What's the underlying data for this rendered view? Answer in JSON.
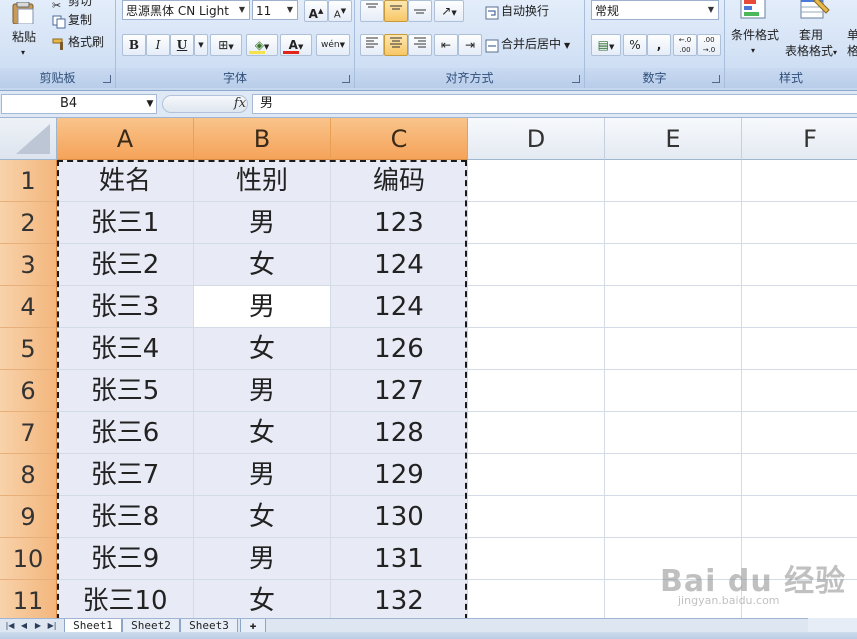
{
  "ribbon": {
    "clipboard": {
      "title": "剪贴板",
      "paste": "粘贴",
      "cut": "剪切",
      "copy": "复制",
      "format_painter": "格式刷"
    },
    "font": {
      "title": "字体",
      "font_name": "思源黑体 CN Light",
      "font_size": "11",
      "bold": "B",
      "italic": "I",
      "underline": "U",
      "font_color_glyph": "A",
      "phonetic": "wén",
      "grow": "A",
      "shrink": "A"
    },
    "alignment": {
      "title": "对齐方式",
      "wrap_text": "自动换行",
      "merge_center": "合并后居中"
    },
    "number": {
      "title": "数字",
      "format": "常规",
      "percent": "%",
      "comma": ",",
      "inc_decimal": "←.0 .00",
      "dec_decimal": ".00 →.0"
    },
    "styles": {
      "title": "样式",
      "conditional": "条件格式",
      "table_format_1": "套用",
      "table_format_2": "表格格式",
      "cell_styles": "单",
      "cell_styles_2": "格"
    }
  },
  "formula_bar": {
    "cell_ref": "B4",
    "fx": "fx",
    "content": "男"
  },
  "grid": {
    "columns": [
      "A",
      "B",
      "C",
      "D",
      "E",
      "F"
    ],
    "rows": [
      "1",
      "2",
      "3",
      "4",
      "5",
      "6",
      "7",
      "8",
      "9",
      "10",
      "11"
    ],
    "cells": [
      [
        "姓名",
        "性别",
        "编码"
      ],
      [
        "张三1",
        "男",
        "123"
      ],
      [
        "张三2",
        "女",
        "124"
      ],
      [
        "张三3",
        "男",
        "124"
      ],
      [
        "张三4",
        "女",
        "126"
      ],
      [
        "张三5",
        "男",
        "127"
      ],
      [
        "张三6",
        "女",
        "128"
      ],
      [
        "张三7",
        "男",
        "129"
      ],
      [
        "张三8",
        "女",
        "130"
      ],
      [
        "张三9",
        "男",
        "131"
      ],
      [
        "张三10",
        "女",
        "132"
      ]
    ]
  },
  "sheets": {
    "tabs": [
      "Sheet1",
      "Sheet2",
      "Sheet3"
    ]
  },
  "watermark": {
    "text": "Bai du 经验",
    "sub": "jingyan.baidu.com"
  },
  "colors": {
    "selected_header": "#f5a35a",
    "selection_fill": "#e8ebf5",
    "ribbon_bg": "#d5e3f6"
  }
}
